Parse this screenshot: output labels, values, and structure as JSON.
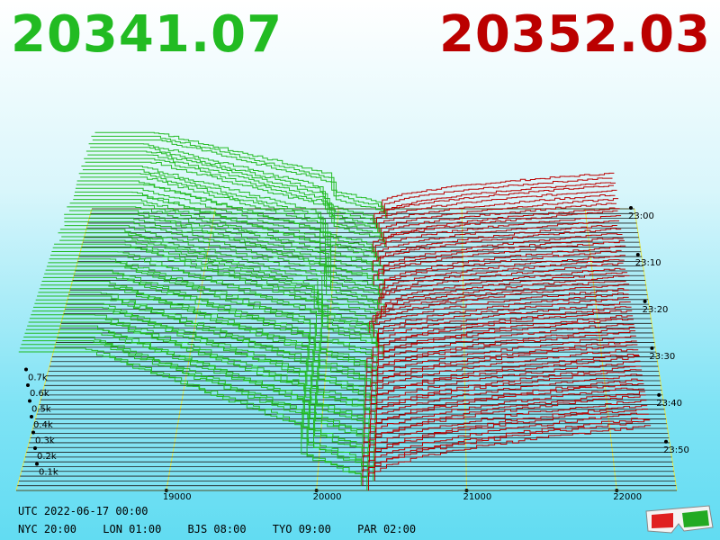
{
  "header": {
    "bid_price": "20341.07",
    "ask_price": "20352.03"
  },
  "footer": {
    "utc": "UTC 2022-06-17 00:00",
    "zones": [
      "NYC 20:00",
      "LON 01:00",
      "BJS 08:00",
      "TYO 09:00",
      "PAR 02:00"
    ]
  },
  "colors": {
    "bid": "#22bb22",
    "ask": "#bb0000",
    "grid": "#e8e84a",
    "depth_lines": "#1a1a1a",
    "glasses_icon": "3d-glasses-icon"
  },
  "chart_data": {
    "type": "area",
    "title": "",
    "x_ticks": [
      "19000",
      "20000",
      "21000",
      "22000"
    ],
    "xlim": [
      18000,
      22400
    ],
    "depth_ticks": [
      "0.1k",
      "0.2k",
      "0.3k",
      "0.4k",
      "0.5k",
      "0.6k",
      "0.7k"
    ],
    "time_ticks": [
      "23:00",
      "23:10",
      "23:20",
      "23:30",
      "23:40",
      "23:50"
    ],
    "snapshots": 60,
    "bid_price": 20341.07,
    "ask_price": 20352.03,
    "bid_depth_max_k": 0.7,
    "ask_depth_max_k": 0.4,
    "grid": true
  }
}
